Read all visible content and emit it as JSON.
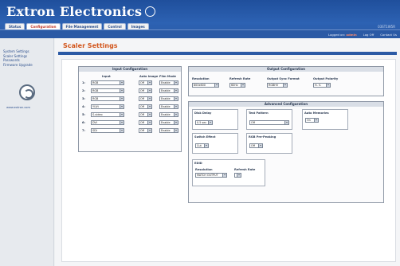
{
  "header": {
    "brand": "Extron Electronics",
    "tabs": [
      "Status",
      "Configuration",
      "File Management",
      "Control",
      "Images"
    ],
    "serial": "03ST1W5R",
    "logged_in_label": "Logged on:",
    "user": "admin",
    "logoff": "Log Off",
    "contact": "Contact Us"
  },
  "sidebar": {
    "links": [
      "System Settings",
      "Scaler Settings",
      "Passwords",
      "Firmware Upgrade"
    ],
    "url": "www.extron.com"
  },
  "main": {
    "title": "Scaler Settings",
    "input_config": {
      "title": "Input Configuration",
      "col_input": "Input",
      "col_auto": "Auto Image",
      "col_film": "Film Mode",
      "rows": [
        {
          "num": "1:",
          "input": "RGB",
          "auto": "Off",
          "film": "Enable"
        },
        {
          "num": "2:",
          "input": "RGB",
          "auto": "Off",
          "film": "Enable"
        },
        {
          "num": "3:",
          "input": "RGB",
          "auto": "Off",
          "film": "Enable"
        },
        {
          "num": "4:",
          "input": "YUVi",
          "auto": "Off",
          "film": "Enable"
        },
        {
          "num": "5:",
          "input": "S-video",
          "auto": "Off",
          "film": "Enable"
        },
        {
          "num": "6:",
          "input": "DVI",
          "auto": "Off",
          "film": "Enable"
        },
        {
          "num": "7:",
          "input": "SDI",
          "auto": "Off",
          "film": "Enable"
        }
      ]
    },
    "output_config": {
      "title": "Output Configuration",
      "resolution_label": "Resolution",
      "resolution": "800x600",
      "refresh_label": "Refresh Rate",
      "refresh": "60Hz",
      "sync_label": "Output Sync Format",
      "sync": "RGBHV",
      "polarity_label": "Output Polarity",
      "polarity": "H- V-"
    },
    "advanced_config": {
      "title": "Advanced Configuration",
      "disk_delay_label": "Disk Delay",
      "disk_delay": "0.5 sec",
      "test_pattern_label": "Test Pattern",
      "test_pattern": "Off",
      "auto_memories_label": "Auto Memories",
      "auto_memories": "On",
      "switch_effect_label": "Switch Effect",
      "switch_effect": "Cut",
      "rgb_prepeaking_label": "RGB Pre-Peaking",
      "rgb_prepeaking": "Off",
      "edid_label": "EDID",
      "edid_resolution_label": "Resolution",
      "edid_resolution": "MATCH OUTPUT",
      "edid_refresh_label": "Refresh Rate",
      "edid_refresh": ""
    }
  }
}
